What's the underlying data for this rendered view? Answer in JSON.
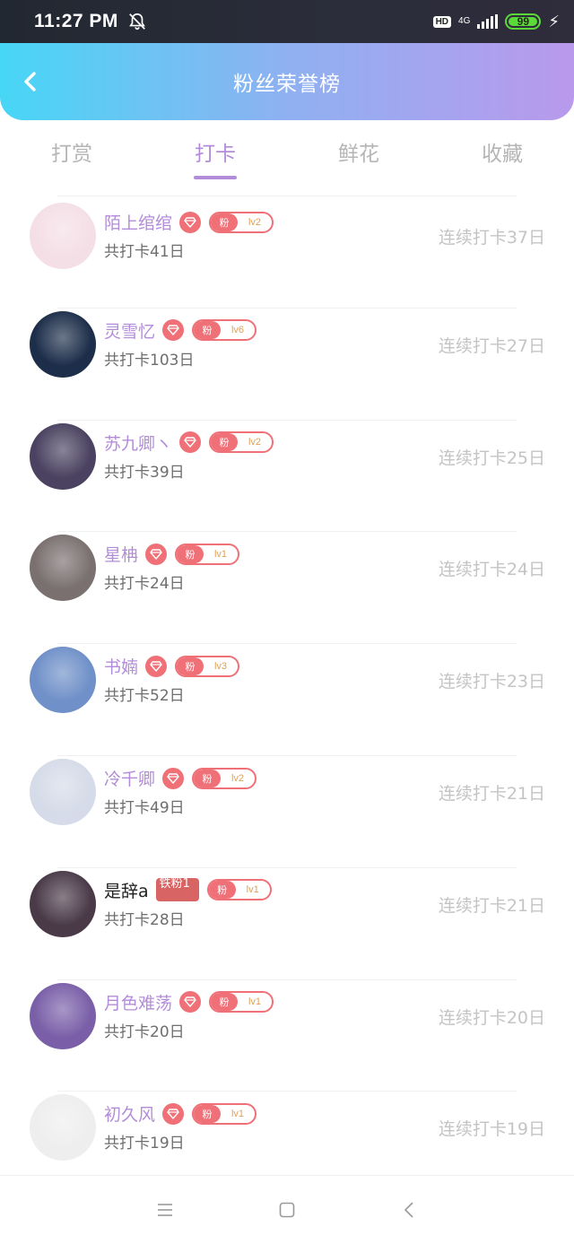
{
  "status_bar": {
    "time": "11:27 PM",
    "hd": "HD",
    "network": "4G",
    "battery_level": "99",
    "icons": [
      "mute-bell-icon",
      "signal-icon",
      "battery-icon",
      "charging-bolt-icon"
    ]
  },
  "header": {
    "title": "粉丝荣誉榜",
    "back_icon": "chevron-left-icon"
  },
  "tabs": [
    {
      "label": "打赏",
      "active": false
    },
    {
      "label": "打卡",
      "active": true
    },
    {
      "label": "鲜花",
      "active": false
    },
    {
      "label": "收藏",
      "active": false
    }
  ],
  "fan_badge_label": "粉",
  "rows": [
    {
      "name": "陌上绾绾",
      "badge": "diamond",
      "level": "lv2",
      "total": "共打卡41日",
      "streak": "连续打卡37日",
      "avatar_color": "#f4dfe6"
    },
    {
      "name": "灵雪忆",
      "badge": "diamond",
      "level": "lv6",
      "total": "共打卡103日",
      "streak": "连续打卡27日",
      "avatar_color": "#1d2e4a"
    },
    {
      "name": "苏九卿ヽ",
      "badge": "diamond",
      "level": "lv2",
      "total": "共打卡39日",
      "streak": "连续打卡25日",
      "avatar_color": "#4a4260"
    },
    {
      "name": "星柟",
      "badge": "diamond",
      "level": "lv1",
      "total": "共打卡24日",
      "streak": "连续打卡24日",
      "avatar_color": "#7a7070"
    },
    {
      "name": "书婻",
      "badge": "diamond",
      "level": "lv3",
      "total": "共打卡52日",
      "streak": "连续打卡23日",
      "avatar_color": "#6f90c8"
    },
    {
      "name": "冷千卿",
      "badge": "diamond",
      "level": "lv2",
      "total": "共打卡49日",
      "streak": "连续打卡21日",
      "avatar_color": "#d5dbe8"
    },
    {
      "name": "是辞a",
      "badge": "iron",
      "iron_label": "铁粉1",
      "level": "lv1",
      "total": "共打卡28日",
      "streak": "连续打卡21日",
      "avatar_color": "#4a3a48"
    },
    {
      "name": "月色难荡",
      "badge": "diamond",
      "level": "lv1",
      "total": "共打卡20日",
      "streak": "连续打卡20日",
      "avatar_color": "#7a5fa8"
    },
    {
      "name": "初久风",
      "badge": "diamond",
      "level": "lv1",
      "total": "共打卡19日",
      "streak": "连续打卡19日",
      "avatar_color": "#eeeeee"
    }
  ],
  "nav_bar": {
    "icons": [
      "menu-icon",
      "home-square-icon",
      "back-triangle-icon"
    ]
  }
}
